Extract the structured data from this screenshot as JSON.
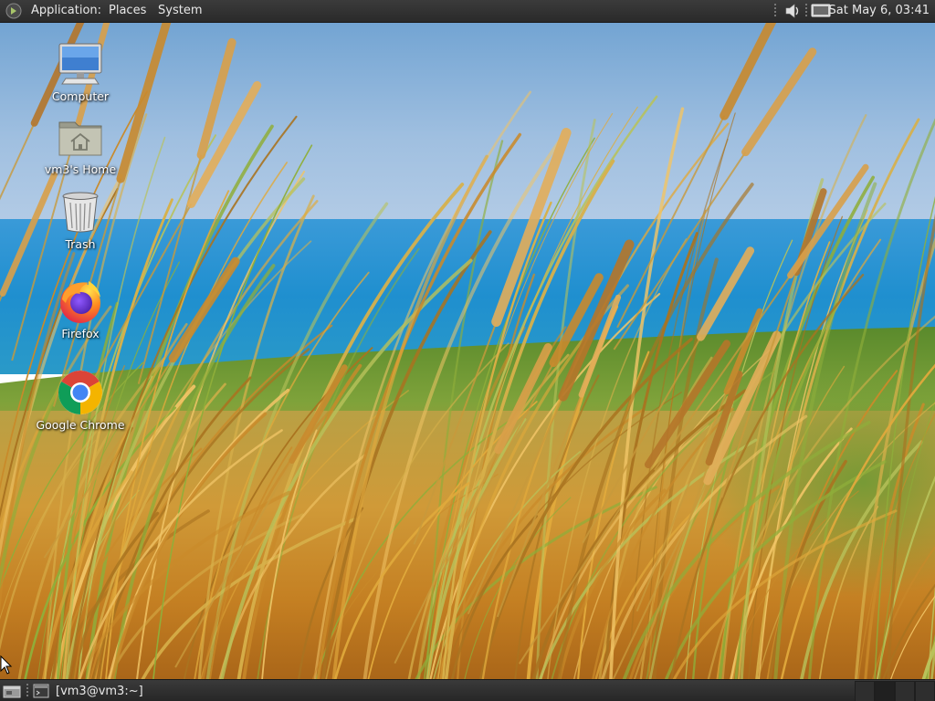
{
  "top_panel": {
    "menus": {
      "applications": "Application:",
      "places": "Places",
      "system": "System"
    },
    "clock": "Sat May  6, 03:41",
    "tray_icons": [
      "volume-icon",
      "network-display-icon"
    ]
  },
  "desktop": {
    "icons": [
      {
        "name": "computer",
        "label": "Computer",
        "icon": "computer-monitor-icon"
      },
      {
        "name": "home",
        "label": "vm3's Home",
        "icon": "home-folder-icon"
      },
      {
        "name": "trash",
        "label": "Trash",
        "icon": "trash-icon"
      },
      {
        "name": "firefox",
        "label": "Firefox",
        "icon": "firefox-icon"
      },
      {
        "name": "chrome",
        "label": "Google Chrome",
        "icon": "chrome-icon"
      }
    ]
  },
  "bottom_panel": {
    "taskbar_item": "[vm3@vm3:~]",
    "workspaces": 4
  },
  "colors": {
    "panel_bg": "#2e2e2e",
    "panel_text": "#e8e8e8",
    "sky_top": "#6a9fd0",
    "sea": "#2a8fd0",
    "grass": "#d1982f"
  }
}
